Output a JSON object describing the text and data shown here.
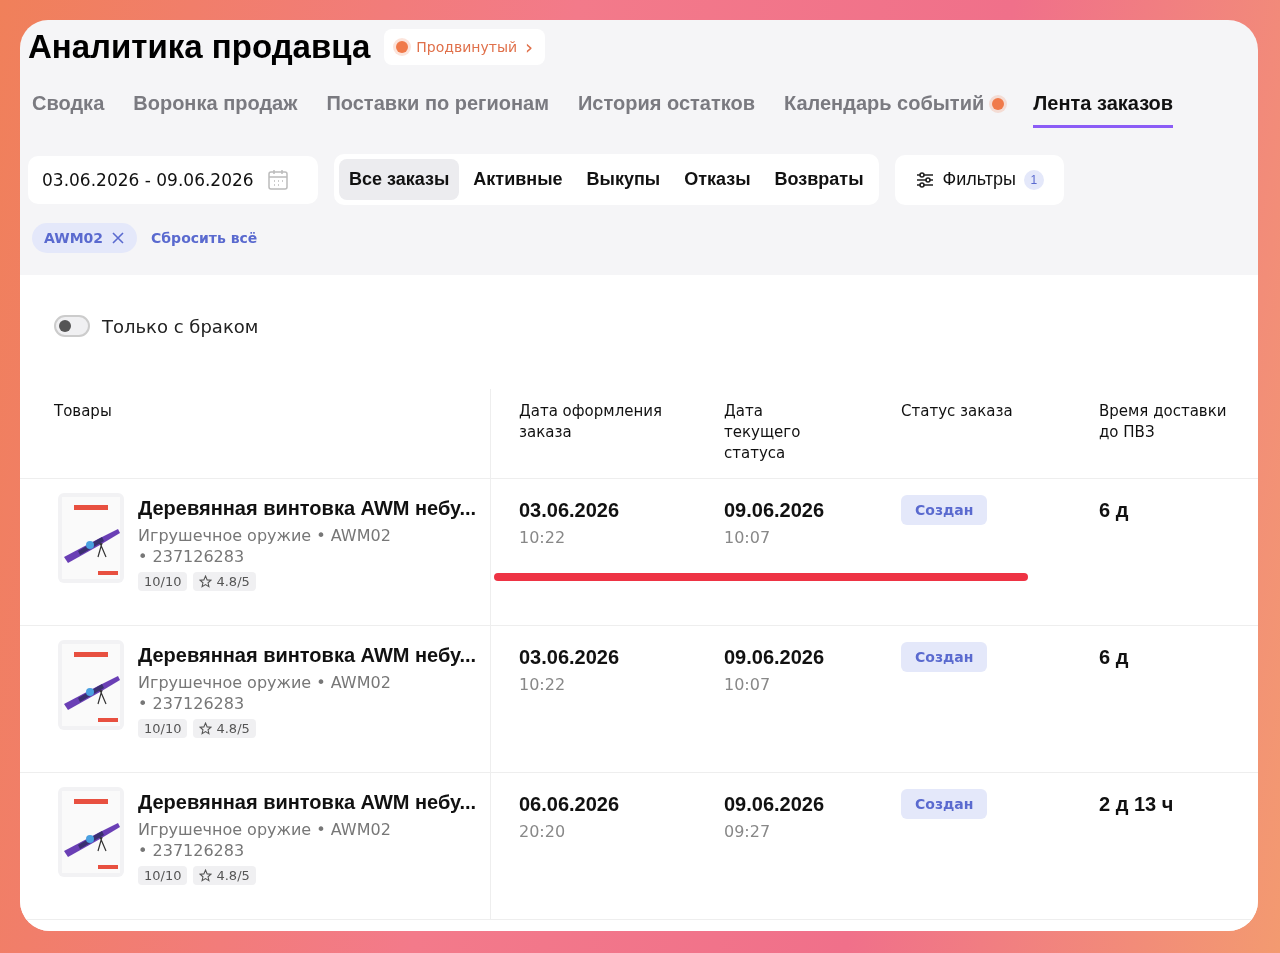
{
  "title": "Аналитика продавца",
  "plan_badge": {
    "label": "Продвинутый",
    "arrow": "›"
  },
  "tabs": [
    {
      "label": "Сводка",
      "selected": false,
      "dot": false
    },
    {
      "label": "Воронка продаж",
      "selected": false,
      "dot": false
    },
    {
      "label": "Поставки по регионам",
      "selected": false,
      "dot": false
    },
    {
      "label": "История остатков",
      "selected": false,
      "dot": false
    },
    {
      "label": "Календарь событий",
      "selected": false,
      "dot": true
    },
    {
      "label": "Лента заказов",
      "selected": true,
      "dot": false
    }
  ],
  "date_range": {
    "value": "03.06.2026 - 09.06.2026"
  },
  "segments": [
    {
      "label": "Все заказы",
      "selected": true
    },
    {
      "label": "Активные",
      "selected": false
    },
    {
      "label": "Выкупы",
      "selected": false
    },
    {
      "label": "Отказы",
      "selected": false
    },
    {
      "label": "Возвраты",
      "selected": false
    }
  ],
  "filters": {
    "label": "Фильтры",
    "count": "1"
  },
  "active_filters": [
    {
      "label": "AWM02"
    }
  ],
  "reset_link": "Сбросить всё",
  "defect_toggle": {
    "label": "Только с браком",
    "on": false
  },
  "table": {
    "columns": [
      "Товары",
      "Дата оформления заказа",
      "Дата текущего статуса",
      "Статус заказа",
      "Время доставки до ПВЗ"
    ],
    "rows": [
      {
        "name": "Деревянная винтовка AWM небу...",
        "category": "Игрушечное оружие • AWM02",
        "article": "• 237126283",
        "score": "10/10",
        "rating": "4.8/5",
        "order_date": "03.06.2026",
        "order_time": "10:22",
        "status_date": "09.06.2026",
        "status_time": "10:07",
        "status": "Создан",
        "delivery": "6 д",
        "underlined": true
      },
      {
        "name": "Деревянная винтовка AWM небу...",
        "category": "Игрушечное оружие • AWM02",
        "article": "• 237126283",
        "score": "10/10",
        "rating": "4.8/5",
        "order_date": "03.06.2026",
        "order_time": "10:22",
        "status_date": "09.06.2026",
        "status_time": "10:07",
        "status": "Создан",
        "delivery": "6 д",
        "underlined": false
      },
      {
        "name": "Деревянная винтовка AWM небу...",
        "category": "Игрушечное оружие • AWM02",
        "article": "• 237126283",
        "score": "10/10",
        "rating": "4.8/5",
        "order_date": "06.06.2026",
        "order_time": "20:20",
        "status_date": "09.06.2026",
        "status_time": "09:27",
        "status": "Создан",
        "delivery": "2 д 13 ч",
        "underlined": false
      }
    ]
  }
}
